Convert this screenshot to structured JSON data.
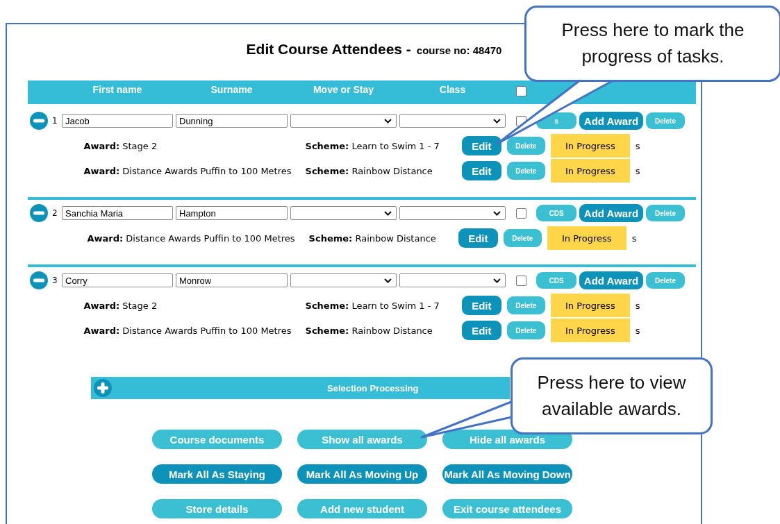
{
  "title": "Edit Course Attendees -",
  "course": "course no: 48470",
  "header": {
    "columns": [
      "First name",
      "Surname",
      "Move or Stay",
      "Class"
    ],
    "select_all_checked": false
  },
  "students": [
    {
      "number": "1",
      "first_name": "Jacob",
      "surname": "Dunning",
      "expanded": true,
      "checked": false,
      "cds": "s",
      "add_award": "Add Award",
      "delete": "Delete",
      "awards": [
        {
          "award": "**Award:** Stage 2",
          "scheme": "**Scheme:** Learn to Swim 1 - 7",
          "edit": "Edit",
          "delete": "Delete",
          "status": "In Progress",
          "suffix": "s"
        },
        {
          "award": "**Award:** Distance Awards Puffin to 100 Metres",
          "scheme": "**Scheme:** Rainbow Distance",
          "edit": "Edit",
          "delete": "Delete",
          "status": "In Progress",
          "suffix": "s"
        }
      ]
    },
    {
      "number": "2",
      "first_name": "Sanchia Maria",
      "surname": "Hampton",
      "expanded": true,
      "checked": false,
      "cds": "CDS",
      "add_award": "Add Award",
      "delete": "Delete",
      "awards": [
        {
          "award": "**Award:** Distance Awards Puffin to 100 Metres",
          "scheme": "**Scheme:** Rainbow Distance",
          "edit": "Edit",
          "delete": "Delete",
          "status": "In Progress",
          "suffix": "s"
        }
      ]
    },
    {
      "number": "3",
      "first_name": "Corry",
      "surname": "Monrow",
      "expanded": true,
      "checked": false,
      "cds": "CDS",
      "add_award": "Add Award",
      "delete": "Delete",
      "awards": [
        {
          "award": "**Award:** Stage 2",
          "scheme": "**Scheme:** Learn to Swim 1 - 7",
          "edit": "Edit",
          "delete": "Delete",
          "status": "In Progress",
          "suffix": "s"
        },
        {
          "award": "**Award:** Distance Awards Puffin to 100 Metres",
          "scheme": "**Scheme:** Rainbow Distance",
          "edit": "Edit",
          "delete": "Delete",
          "status": "In Progress",
          "suffix": "s"
        }
      ]
    }
  ],
  "selection_processing": {
    "label": "Selection Processing",
    "expanded": false
  },
  "actions": [
    {
      "label": "Course documents",
      "kind": "light"
    },
    {
      "label": "Show all awards",
      "kind": "light"
    },
    {
      "label": "Hide all awards",
      "kind": "light"
    },
    {
      "label": "Mark All As Staying",
      "kind": "dark"
    },
    {
      "label": "Mark All As Moving Up",
      "kind": "dark"
    },
    {
      "label": "Mark All As Moving Down",
      "kind": "dark"
    },
    {
      "label": "Store details",
      "kind": "light"
    },
    {
      "label": "Add new student",
      "kind": "light"
    },
    {
      "label": "Exit course attendees",
      "kind": "light"
    }
  ],
  "callouts": [
    {
      "text": "Press here to mark the progress of tasks."
    },
    {
      "text": "Press here to view available awards."
    }
  ]
}
